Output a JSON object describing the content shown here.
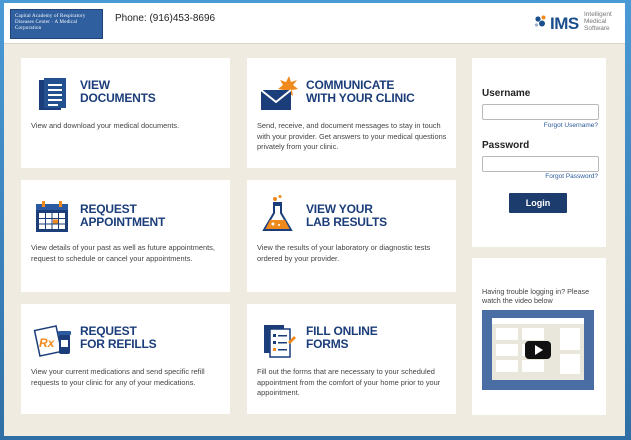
{
  "header": {
    "clinic_logo_text": "Capital Academy of Respiratory Diseases Center · A Medical Corporation",
    "phone": "Phone: (916)453-8696",
    "vendor_name": "IMS",
    "vendor_tagline": [
      "Intelligent",
      "Medical",
      "Software"
    ]
  },
  "cards": {
    "view_documents": {
      "title": [
        "VIEW",
        "DOCUMENTS"
      ],
      "description": "View and download your medical documents.",
      "icon": "document-icon"
    },
    "communicate": {
      "title": [
        "COMMUNICATE",
        "WITH YOUR CLINIC"
      ],
      "description": "Send, receive, and document messages to stay in touch with your provider. Get answers to your medical questions privately from your clinic.",
      "icon": "envelope-icon"
    },
    "request_appointment": {
      "title": [
        "REQUEST",
        "APPOINTMENT"
      ],
      "description": "View details of your past as well as future appointments, request to schedule or cancel your appointments.",
      "icon": "calendar-icon"
    },
    "lab_results": {
      "title": [
        "VIEW YOUR",
        "LAB RESULTS"
      ],
      "description": "View the results of your laboratory or diagnostic tests ordered by your provider.",
      "icon": "flask-icon"
    },
    "request_refills": {
      "title": [
        "REQUEST",
        "FOR REFILLS"
      ],
      "description": "View your current medications and send specific refill requests to your clinic for any of your medications.",
      "icon": "prescription-icon"
    },
    "fill_forms": {
      "title": [
        "FILL ONLINE",
        "FORMS"
      ],
      "description": "Fill out the forms that are necessary to your scheduled appointment from the comfort of your home prior to your appointment.",
      "icon": "forms-icon"
    }
  },
  "login": {
    "username_label": "Username",
    "username_value": "",
    "forgot_username": "Forgot Username?",
    "password_label": "Password",
    "password_value": "",
    "forgot_password": "Forgot Password?",
    "login_button": "Login"
  },
  "help": {
    "text": "Having trouble logging in? Please watch the video below"
  },
  "colors": {
    "accent": "#1b3d7a",
    "button": "#1d3c6e",
    "page_bg": "#efebe0",
    "frame": "#3a7fb5",
    "icon_orange": "#f08a1c"
  }
}
